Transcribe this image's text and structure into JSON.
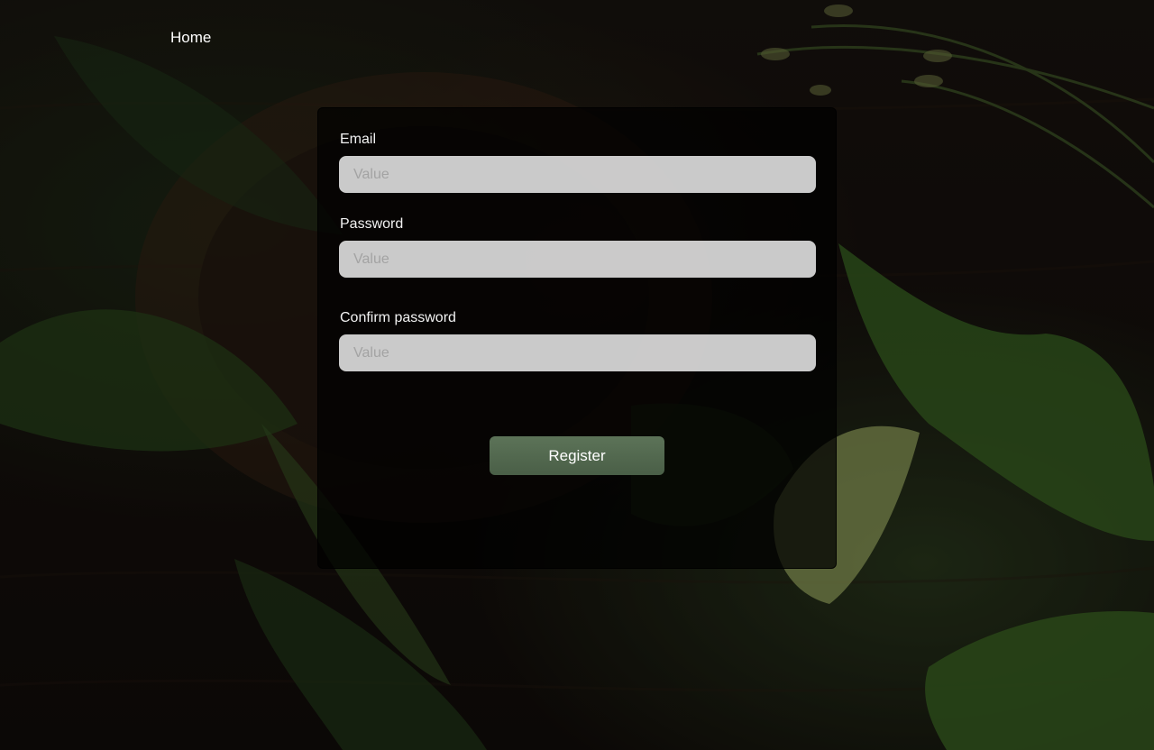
{
  "nav": {
    "home_label": "Home"
  },
  "form": {
    "email": {
      "label": "Email",
      "placeholder": "Value",
      "value": ""
    },
    "password": {
      "label": "Password",
      "placeholder": "Value",
      "value": ""
    },
    "confirm_password": {
      "label": "Confirm password",
      "placeholder": "Value",
      "value": ""
    },
    "submit_label": "Register"
  },
  "colors": {
    "button_accent": "#56704f",
    "card_background": "#000000",
    "input_background": "#e6e6e6"
  }
}
